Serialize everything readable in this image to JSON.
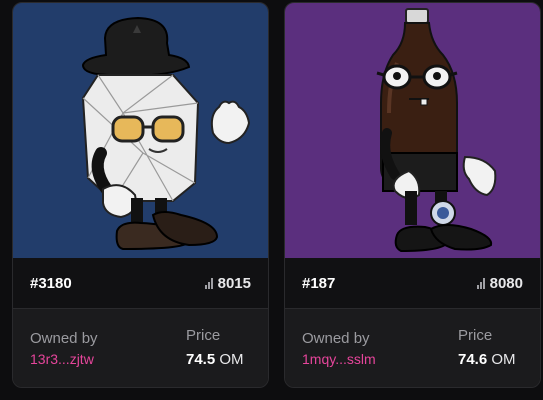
{
  "cards": [
    {
      "token_id": "#3180",
      "rank": "8015",
      "owned_label": "Owned by",
      "owner": "13r3...zjtw",
      "price_label": "Price",
      "price_value": "74.5",
      "price_unit": "OM",
      "art_background": "#223d6b",
      "art_icon": "diamond-character-art"
    },
    {
      "token_id": "#187",
      "rank": "8080",
      "owned_label": "Owned by",
      "owner": "1mqy...sslm",
      "price_label": "Price",
      "price_value": "74.6",
      "price_unit": "OM",
      "art_background": "#5b2f7e",
      "art_icon": "bottle-character-art"
    }
  ],
  "colors": {
    "owner_link": "#e6459b",
    "card_bg": "#1b1b1d",
    "page_bg": "#0d0d0f"
  }
}
